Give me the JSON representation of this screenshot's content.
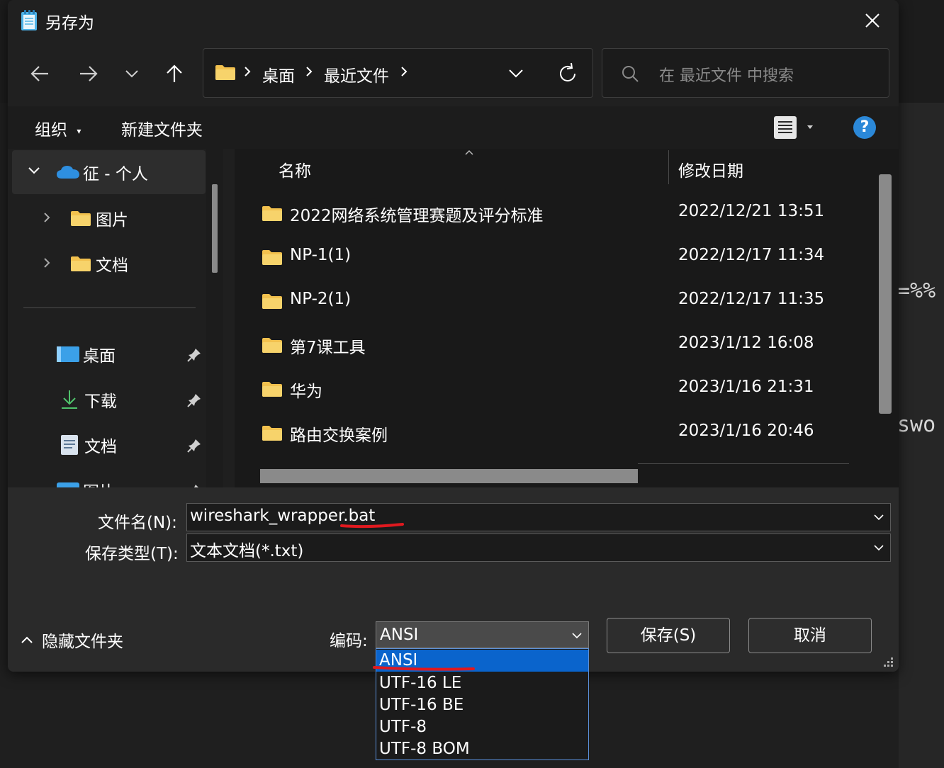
{
  "background": {
    "text_line1": "=%%",
    "text_line2": "swo"
  },
  "titlebar": {
    "icon": "notepad-icon",
    "title": "另存为",
    "close_icon": "close-icon"
  },
  "nav": {
    "back_icon": "arrow-left-icon",
    "forward_icon": "arrow-right-icon",
    "recent_icon": "chevron-down-icon",
    "up_icon": "arrow-up-icon",
    "breadcrumb": [
      "桌面",
      "最近文件"
    ],
    "search_placeholder": "在 最近文件 中搜索"
  },
  "commandbar": {
    "organize": "组织",
    "new_folder": "新建文件夹",
    "help": "?"
  },
  "navpane": {
    "onedrive_label": "征 - 个人",
    "items": [
      {
        "label": "图片",
        "icon": "folder-icon"
      },
      {
        "label": "文档",
        "icon": "folder-icon"
      }
    ],
    "quick_access": [
      {
        "label": "桌面",
        "icon": "desktop-icon"
      },
      {
        "label": "下载",
        "icon": "download-icon"
      },
      {
        "label": "文档",
        "icon": "document-icon"
      },
      {
        "label": "图片",
        "icon": "picture-icon"
      }
    ]
  },
  "filelist": {
    "columns": {
      "name": "名称",
      "date": "修改日期"
    },
    "rows": [
      {
        "name": "2022网络系统管理赛题及评分标准",
        "date": "2022/12/21 13:51"
      },
      {
        "name": "NP-1(1)",
        "date": "2022/12/17 11:34"
      },
      {
        "name": "NP-2(1)",
        "date": "2022/12/17 11:35"
      },
      {
        "name": "第7课工具",
        "date": "2023/1/12 16:08"
      },
      {
        "name": "华为",
        "date": "2023/1/16 21:31"
      },
      {
        "name": "路由交换案例",
        "date": "2023/1/16 20:46"
      }
    ]
  },
  "form": {
    "filename_label": "文件名(N):",
    "filename_value": "wireshark_wrapper.bat",
    "filetype_label": "保存类型(T):",
    "filetype_value": "文本文档(*.txt)",
    "encoding_label": "编码:",
    "encoding_value": "ANSI",
    "encoding_options": [
      "ANSI",
      "UTF-16 LE",
      "UTF-16 BE",
      "UTF-8",
      "UTF-8 BOM"
    ],
    "hide_folders": "隐藏文件夹",
    "save": "保存(S)",
    "cancel": "取消"
  },
  "colors": {
    "accent": "#0a64cc",
    "folder": "#f2c14e",
    "annotation": "#e0191f"
  }
}
